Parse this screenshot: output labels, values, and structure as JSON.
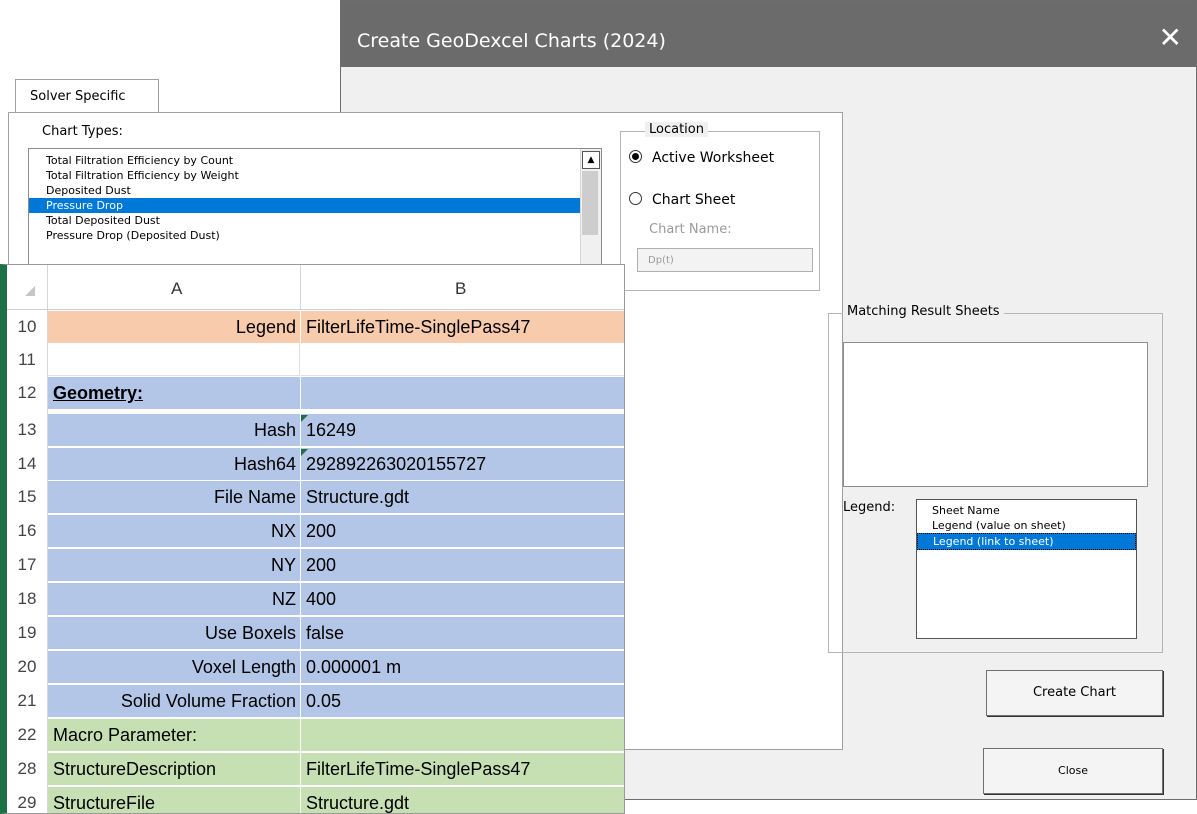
{
  "dialog": {
    "title": "Create GeoDexcel Charts (2024)",
    "close_glyph": "✕",
    "tab_label": "Solver Specific",
    "chart_types_label": "Chart Types:",
    "chart_types": [
      "Total Filtration Efficiency by Count",
      "Total Filtration Efficiency by Weight",
      "Deposited Dust",
      "Pressure Drop",
      "Total Deposited Dust",
      "Pressure Drop (Deposited Dust)"
    ],
    "chart_types_selected": "Pressure Drop",
    "location": {
      "label": "Location",
      "active_worksheet": "Active Worksheet",
      "chart_sheet": "Chart Sheet",
      "chart_name_label": "Chart Name:",
      "chart_name_value": "Dp(t)"
    },
    "matching_label": "Matching Result Sheets",
    "legend_label": "Legend:",
    "legend_options": [
      "Sheet Name",
      "Legend (value on sheet)",
      "Legend (link to sheet)"
    ],
    "legend_selected": "Legend (link to sheet)",
    "create_button": "Create Chart",
    "close_button": "Close"
  },
  "sheet": {
    "columns": [
      "A",
      "B"
    ],
    "rows": [
      {
        "num": "10",
        "a": "Legend",
        "b": "FilterLifeTime-SinglePass47"
      },
      {
        "num": "11",
        "a": "",
        "b": ""
      },
      {
        "num": "12",
        "a": "Geometry:",
        "b": ""
      },
      {
        "num": "13",
        "a": "Hash",
        "b": "16249"
      },
      {
        "num": "14",
        "a": "Hash64",
        "b": "292892263020155727"
      },
      {
        "num": "15",
        "a": "File Name",
        "b": "Structure.gdt"
      },
      {
        "num": "16",
        "a": "NX",
        "b": "200"
      },
      {
        "num": "17",
        "a": "NY",
        "b": "200"
      },
      {
        "num": "18",
        "a": "NZ",
        "b": "400"
      },
      {
        "num": "19",
        "a": "Use Boxels",
        "b": "false"
      },
      {
        "num": "20",
        "a": "Voxel Length",
        "b": "0.000001 m"
      },
      {
        "num": "21",
        "a": "Solid Volume Fraction",
        "b": "0.05"
      },
      {
        "num": "22",
        "a": "Macro Parameter:",
        "b": ""
      },
      {
        "num": "28",
        "a": "StructureDescription",
        "b": "FilterLifeTime-SinglePass47"
      },
      {
        "num": "29",
        "a": "StructureFile",
        "b": "Structure.gdt"
      }
    ]
  }
}
